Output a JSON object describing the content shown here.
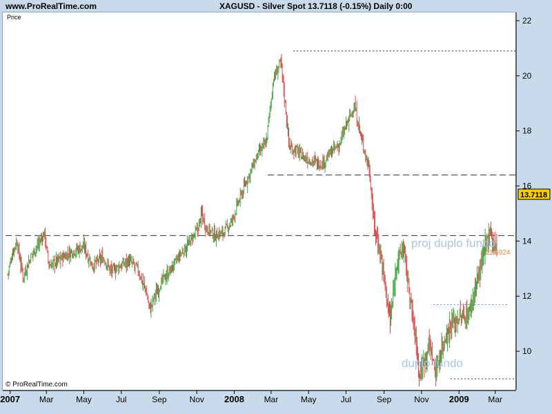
{
  "header": {
    "site": "www.ProRealTime.com",
    "symbol_line": "XAGUSD - Silver Spot    13.7118 (-0.15%)    Daily  0:00"
  },
  "panel": {
    "price_label": "Price",
    "copyright": "© ProRealTime.com",
    "last_price": "13.7118",
    "annotation_projection": "proj duplo fundo",
    "annotation_projection_value": "11.6924",
    "annotation_double_bottom": "duplo fundo"
  },
  "colors": {
    "up": "#3fa63f",
    "down": "#d94b4b",
    "background": "#c9dbea",
    "price_tag": "#ffcc00",
    "annotation": "#aac4ea"
  },
  "chart_data": {
    "type": "line",
    "title": "XAGUSD - Silver Spot",
    "ylabel": "Price",
    "ylim": [
      8.6,
      22.3
    ],
    "yticks": [
      10,
      12,
      14,
      16,
      18,
      20,
      22
    ],
    "x_tick_labels": [
      "2007",
      "Mar",
      "May",
      "Jul",
      "Sep",
      "Nov",
      "2008",
      "Mar",
      "May",
      "Jul",
      "Sep",
      "Nov",
      "2009",
      "Mar"
    ],
    "x_tick_dates": [
      "2007-01",
      "2007-03",
      "2007-05",
      "2007-07",
      "2007-09",
      "2007-11",
      "2008-01",
      "2008-03",
      "2008-05",
      "2008-07",
      "2008-09",
      "2008-11",
      "2009-01",
      "2009-03"
    ],
    "series": [
      {
        "x": [
          "2006-12-28",
          "2007-01-05",
          "2007-01-12",
          "2007-01-22",
          "2007-02-05",
          "2007-02-16",
          "2007-02-26",
          "2007-03-05",
          "2007-03-20",
          "2007-04-10",
          "2007-05-01",
          "2007-05-15",
          "2007-06-01",
          "2007-06-15",
          "2007-06-29",
          "2007-07-13",
          "2007-07-27",
          "2007-08-10",
          "2007-08-17",
          "2007-08-24",
          "2007-09-07",
          "2007-09-21",
          "2007-10-05",
          "2007-10-19",
          "2007-11-02",
          "2007-11-09",
          "2007-11-16",
          "2007-11-30",
          "2007-12-14",
          "2007-12-28",
          "2008-01-11",
          "2008-01-25",
          "2008-02-08",
          "2008-02-22",
          "2008-03-05",
          "2008-03-17",
          "2008-03-31",
          "2008-04-11",
          "2008-04-25",
          "2008-05-09",
          "2008-05-23",
          "2008-06-06",
          "2008-06-20",
          "2008-07-03",
          "2008-07-15",
          "2008-07-25",
          "2008-08-08",
          "2008-08-15",
          "2008-08-29",
          "2008-09-05",
          "2008-09-11",
          "2008-09-22",
          "2008-10-03",
          "2008-10-10",
          "2008-10-24",
          "2008-10-28",
          "2008-11-07",
          "2008-11-14",
          "2008-11-24",
          "2008-12-05",
          "2008-12-19",
          "2009-01-02",
          "2009-01-16",
          "2009-01-30",
          "2009-02-13",
          "2009-02-20",
          "2009-02-27",
          "2009-03-04"
        ],
        "values": [
          12.8,
          13.6,
          14.0,
          12.7,
          13.5,
          13.9,
          14.3,
          13.1,
          13.3,
          13.6,
          13.8,
          13.1,
          13.4,
          12.9,
          13.1,
          13.3,
          13.0,
          12.2,
          11.5,
          12.0,
          12.6,
          13.0,
          13.5,
          13.9,
          14.4,
          15.0,
          14.5,
          14.2,
          14.3,
          14.7,
          15.6,
          16.4,
          17.1,
          17.6,
          19.9,
          20.5,
          17.4,
          17.3,
          17.0,
          16.9,
          16.8,
          17.2,
          17.5,
          18.3,
          18.9,
          17.8,
          16.6,
          14.7,
          13.2,
          12.0,
          11.1,
          13.3,
          13.8,
          12.5,
          10.2,
          9.1,
          9.8,
          10.3,
          9.2,
          10.2,
          11.0,
          11.2,
          11.3,
          12.5,
          13.8,
          14.4,
          13.9,
          13.71
        ]
      }
    ],
    "reference_levels": [
      20.9,
      16.4,
      14.2,
      11.6924,
      9.0
    ],
    "annotations": [
      "proj duplo fundo",
      "duplo fundo"
    ]
  }
}
